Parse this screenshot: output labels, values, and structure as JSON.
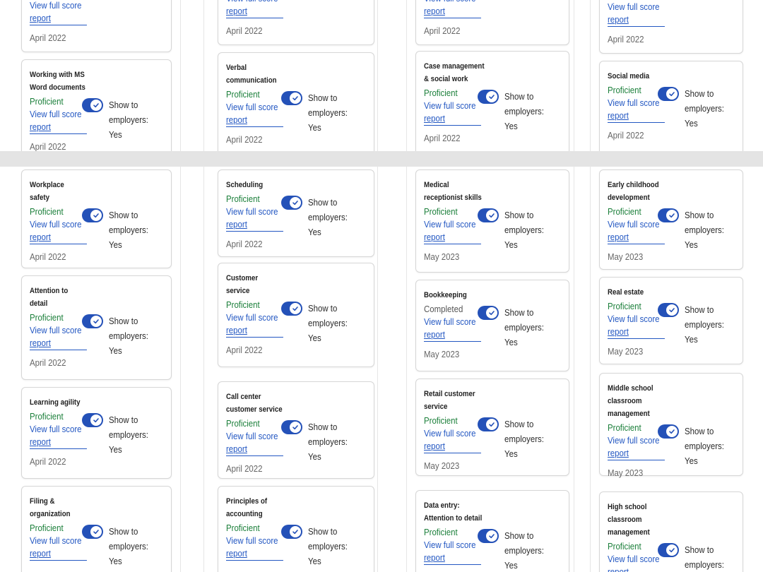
{
  "show_label": "Show to",
  "employers_label": "employers:",
  "yes_label": "Yes",
  "link_label_1": "View full score",
  "link_label_2": "report",
  "accent": "#2451b8",
  "top": {
    "col1": [
      {
        "title_lines": [],
        "status": "",
        "date": "April 2022",
        "partial": true
      },
      {
        "title_lines": [
          "Working with MS",
          "Word documents"
        ],
        "status": "Proficient",
        "date": "April 2022"
      }
    ],
    "col2": [
      {
        "title_lines": [],
        "status": "",
        "date": "April 2022",
        "partial": true
      },
      {
        "title_lines": [
          "Verbal",
          "communication"
        ],
        "status": "Proficient",
        "date": "April 2022"
      }
    ],
    "col3": [
      {
        "title_lines": [],
        "status": "",
        "date": "April 2022",
        "partial": true
      },
      {
        "title_lines": [
          "Case management",
          "& social work"
        ],
        "status": "Proficient",
        "date": "April 2022"
      }
    ],
    "col4": [
      {
        "title_lines": [],
        "status": "",
        "date": "April 2022",
        "partial": true
      },
      {
        "title_lines": [
          "Social media"
        ],
        "status": "Proficient",
        "date": "April 2022"
      }
    ]
  },
  "bottom": {
    "col1": [
      {
        "title_lines": [
          "Workplace",
          "safety"
        ],
        "status": "Proficient",
        "date": "April 2022"
      },
      {
        "title_lines": [
          "Attention to",
          "detail"
        ],
        "status": "Proficient",
        "date": "April 2022"
      },
      {
        "title_lines": [
          "Learning agility"
        ],
        "status": "Proficient",
        "date": "April 2022"
      },
      {
        "title_lines": [
          "Filing &",
          "organization"
        ],
        "status": "Proficient",
        "date": ""
      }
    ],
    "col2": [
      {
        "title_lines": [
          "Scheduling"
        ],
        "status": "Proficient",
        "date": "April 2022"
      },
      {
        "title_lines": [
          "Customer",
          "service"
        ],
        "status": "Proficient",
        "date": "April 2022"
      },
      {
        "title_lines": [
          "Call center",
          "customer service"
        ],
        "status": "Proficient",
        "date": "April 2022"
      },
      {
        "title_lines": [
          "Principles of",
          "accounting"
        ],
        "status": "Proficient",
        "date": ""
      }
    ],
    "col3": [
      {
        "title_lines": [
          "Medical",
          "receptionist skills"
        ],
        "status": "Proficient",
        "date": "May 2023"
      },
      {
        "title_lines": [
          "Bookkeeping"
        ],
        "status": "Completed",
        "date": "May 2023"
      },
      {
        "title_lines": [
          "Retail customer",
          "service"
        ],
        "status": "Proficient",
        "date": "May 2023"
      },
      {
        "title_lines": [
          "Data entry:",
          "Attention to detail"
        ],
        "status": "Proficient",
        "date": ""
      }
    ],
    "col4": [
      {
        "title_lines": [
          "Early childhood",
          "development"
        ],
        "status": "Proficient",
        "date": "May 2023"
      },
      {
        "title_lines": [
          "Real estate"
        ],
        "status": "Proficient",
        "date": "May 2023"
      },
      {
        "title_lines": [
          "Middle school",
          "classroom",
          "management"
        ],
        "status": "Proficient",
        "date": "May 2023"
      },
      {
        "title_lines": [
          "High school",
          "classroom",
          "management"
        ],
        "status": "Proficient",
        "date": ""
      }
    ]
  }
}
